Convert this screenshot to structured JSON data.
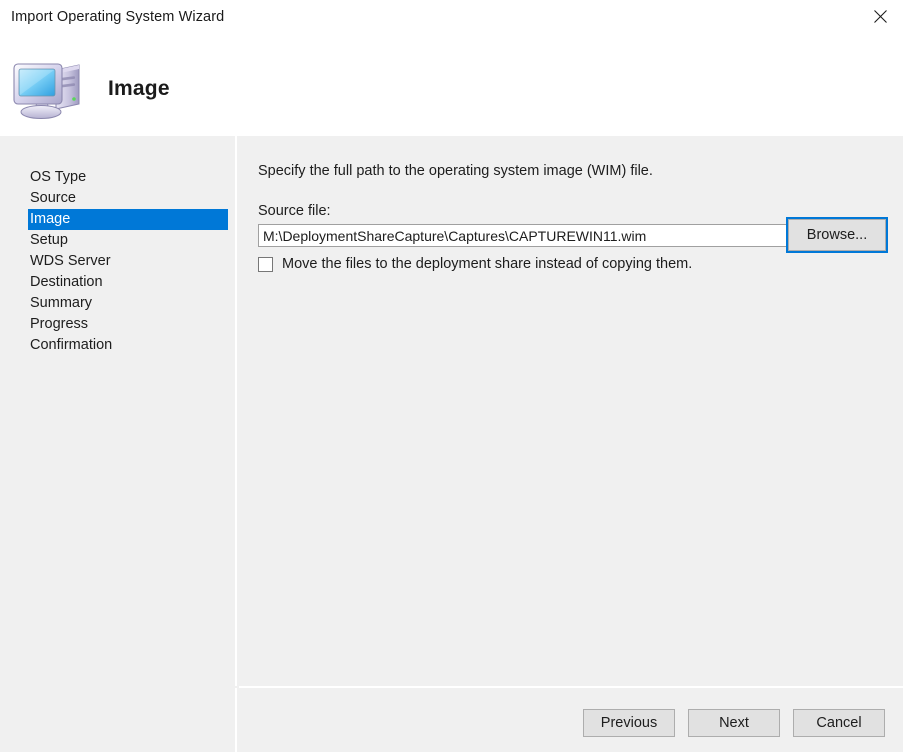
{
  "window": {
    "title": "Import Operating System Wizard",
    "close_icon": "close-icon"
  },
  "header": {
    "icon": "computer-icon",
    "page_title": "Image"
  },
  "sidebar": {
    "steps": [
      {
        "label": "OS Type",
        "active": false
      },
      {
        "label": "Source",
        "active": false
      },
      {
        "label": "Image",
        "active": true
      },
      {
        "label": "Setup",
        "active": false
      },
      {
        "label": "WDS Server",
        "active": false
      },
      {
        "label": "Destination",
        "active": false
      },
      {
        "label": "Summary",
        "active": false
      },
      {
        "label": "Progress",
        "active": false
      },
      {
        "label": "Confirmation",
        "active": false
      }
    ]
  },
  "content": {
    "instruction": "Specify the full path to the operating system image (WIM) file.",
    "source_label": "Source file:",
    "source_value": "M:\\DeploymentShareCapture\\Captures\\CAPTUREWIN11.wim",
    "browse_label": "Browse...",
    "move_checkbox_label": "Move the files to the deployment share instead of copying them.",
    "move_checkbox_checked": false
  },
  "footer": {
    "previous_label": "Previous",
    "next_label": "Next",
    "cancel_label": "Cancel"
  },
  "colors": {
    "accent": "#0078d7",
    "window_bg": "#f0f0f0",
    "titlebar_bg": "#ffffff",
    "button_bg": "#e1e1e1",
    "text": "#1d1d1d"
  }
}
